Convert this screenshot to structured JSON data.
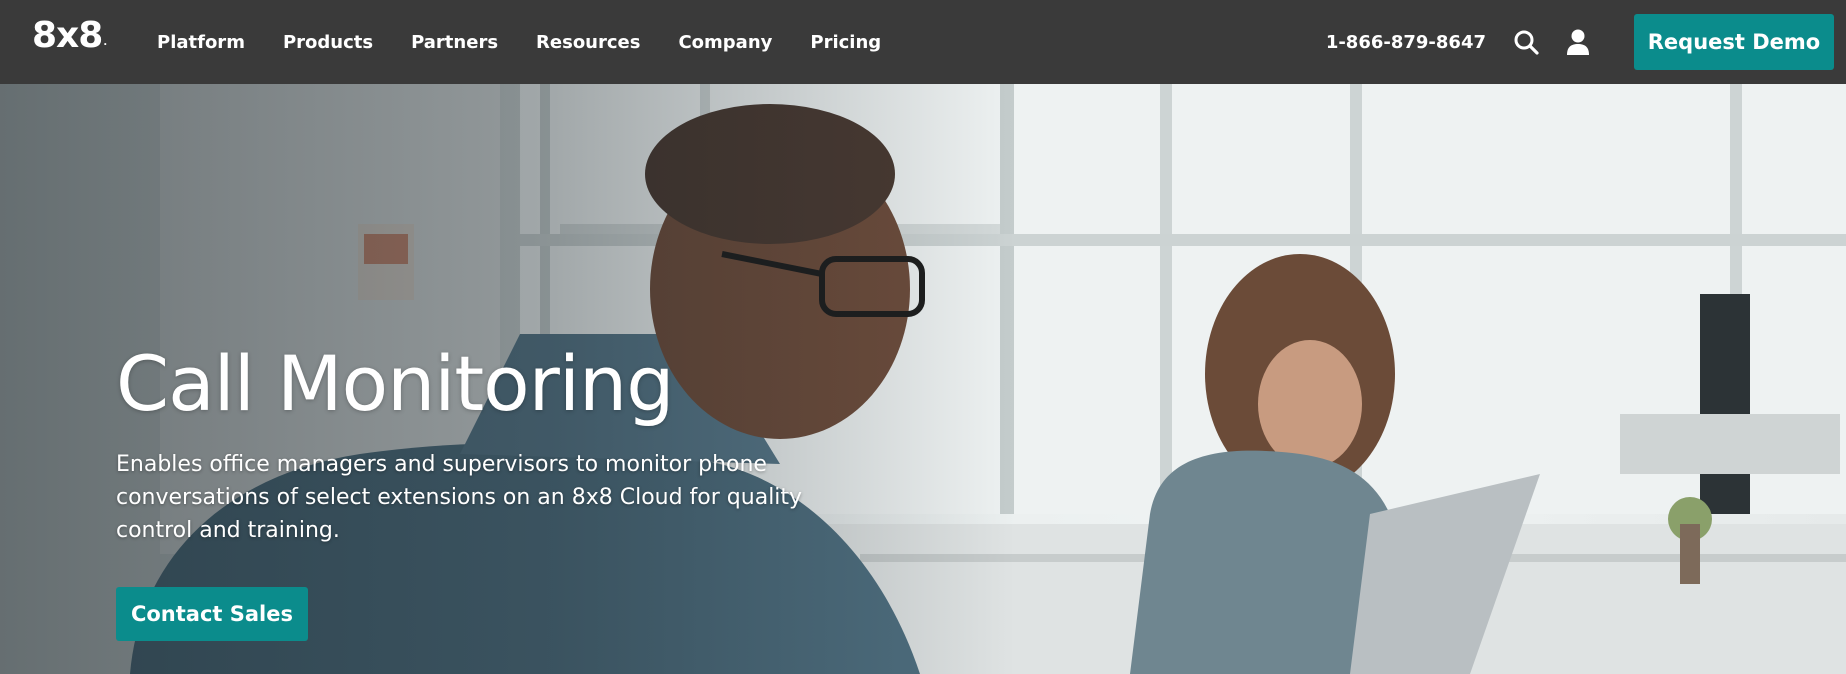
{
  "brand": {
    "logo_text": "8x8",
    "logo_mark": ".",
    "accent_color": "#0b8c8c",
    "nav_bg_color": "#3a3a3a"
  },
  "nav": {
    "links": [
      {
        "label": "Platform"
      },
      {
        "label": "Products"
      },
      {
        "label": "Partners"
      },
      {
        "label": "Resources"
      },
      {
        "label": "Company"
      },
      {
        "label": "Pricing"
      }
    ],
    "phone": "1-866-879-8647",
    "search_icon": "search-icon",
    "account_icon": "user-icon",
    "demo_button": "Request Demo"
  },
  "hero": {
    "title": "Call Monitoring",
    "description": "Enables office managers and supervisors to monitor phone conversations of select extensions on an 8x8 Cloud for quality control and training.",
    "cta_button": "Contact Sales",
    "background_image": "office-workers-photo"
  }
}
